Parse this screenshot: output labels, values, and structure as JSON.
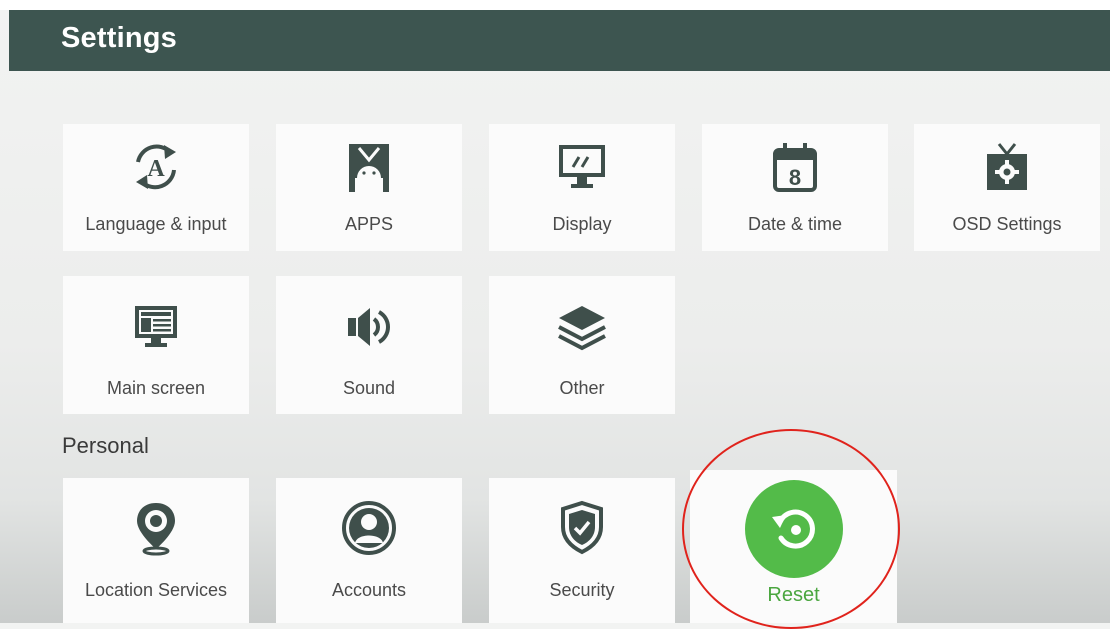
{
  "header": {
    "title": "Settings"
  },
  "grid": {
    "items": [
      {
        "label": "Language & input",
        "icon": "language-icon"
      },
      {
        "label": "APPS",
        "icon": "apps-icon"
      },
      {
        "label": "Display",
        "icon": "display-icon"
      },
      {
        "label": "Date & time",
        "icon": "calendar-icon",
        "icon_text": "8"
      },
      {
        "label": "OSD Settings",
        "icon": "osd-icon"
      },
      {
        "label": "Main screen",
        "icon": "main-screen-icon"
      },
      {
        "label": "Sound",
        "icon": "speaker-icon"
      },
      {
        "label": "Other",
        "icon": "layers-icon"
      }
    ]
  },
  "personal": {
    "title": "Personal",
    "items": [
      {
        "label": "Location Services",
        "icon": "location-pin-icon"
      },
      {
        "label": "Accounts",
        "icon": "account-icon"
      },
      {
        "label": "Security",
        "icon": "shield-icon"
      },
      {
        "label": "Reset",
        "icon": "reset-icon",
        "selected": true
      }
    ]
  },
  "colors": {
    "header_bg": "#3d5550",
    "icon": "#3f4f4b",
    "accent_green": "#53bb49",
    "annotation_red": "#e0231c"
  }
}
